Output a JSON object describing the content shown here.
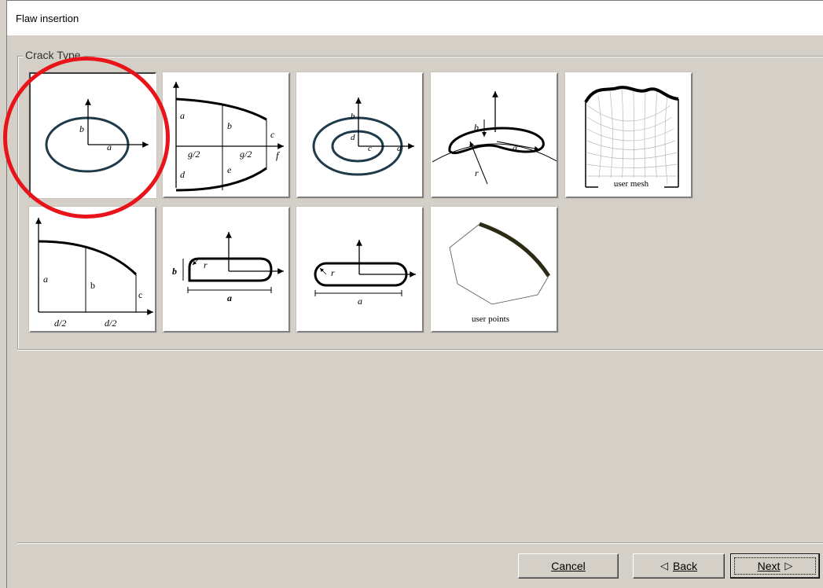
{
  "window": {
    "title": "Flaw insertion"
  },
  "group": {
    "label": "Crack Type"
  },
  "tiles": {
    "ellipse": {
      "a": "a",
      "b": "b"
    },
    "profile": {
      "a": "a",
      "b": "b",
      "c": "c",
      "d": "d",
      "e": "e",
      "f": "f",
      "g1": "g/2",
      "g2": "g/2"
    },
    "ring": {
      "b": "b",
      "c": "c",
      "d": "d",
      "a": "a"
    },
    "surface": {
      "b": "b",
      "a": "a",
      "r": "r"
    },
    "mesh": {
      "label": "user mesh"
    },
    "halfprofile": {
      "a": "a",
      "b": "b",
      "c": "c",
      "d1": "d/2",
      "d2": "d/2"
    },
    "rounded": {
      "b": "b",
      "r": "r",
      "a": "a"
    },
    "stadium": {
      "r": "r",
      "a": "a"
    },
    "points": {
      "label": "user points"
    }
  },
  "buttons": {
    "cancel": {
      "label": "Cancel"
    },
    "back": {
      "label": "Back",
      "arrow": "◁"
    },
    "next": {
      "label": "Next",
      "arrow": "▷"
    }
  },
  "colors": {
    "selection_ring": "#e8141a",
    "dialog_bg": "#d4d0c8"
  }
}
